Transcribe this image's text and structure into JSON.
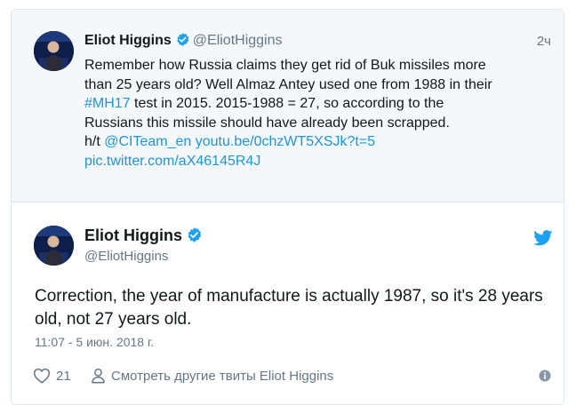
{
  "quoted_tweet": {
    "author_name": "Eliot Higgins",
    "author_handle": "@EliotHiggins",
    "time": "2ч",
    "text_line1": "Remember how Russia claims they get rid of Buk missiles more",
    "text_line2": "than 25 years old? Well Almaz Antey used one from 1988 in their",
    "hashtag": "#MH17",
    "text_line3_rest": " test in 2015. 2015-1988 = 27, so according to the",
    "text_line4": "Russians this missile should have already been scrapped.",
    "ht_prefix": "h/t ",
    "mention": "@CITeam_en",
    "youtube_link": " youtu.be/0chzWT5XSJk?t=5",
    "pic_link": "pic.twitter.com/aX46145R4J"
  },
  "main_tweet": {
    "author_name": "Eliot Higgins",
    "author_handle": "@EliotHiggins",
    "text": "Correction, the year of manufacture is actually 1987, so it's 28 years old, not 27 years old.",
    "timestamp": "11:07 - 5 июн. 2018 г."
  },
  "actions": {
    "likes_count": "21",
    "see_more_label": "Смотреть другие твиты Eliot Higgins"
  },
  "icons": {
    "verified": "verified-badge-icon",
    "twitter_bird": "twitter-bird-icon",
    "heart": "heart-icon",
    "person": "person-icon",
    "info": "info-icon"
  },
  "colors": {
    "link": "#1b95e0",
    "verified": "#1da1f2",
    "muted": "#657786",
    "quoted_background": "#f5f8fa"
  }
}
